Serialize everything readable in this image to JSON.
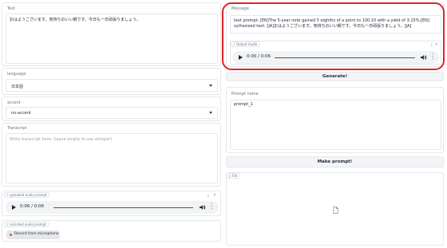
{
  "left": {
    "text": {
      "label": "Text",
      "value": "おはようございます。気持ちのいい朝です。今日も一日頑張りましょう。"
    },
    "language": {
      "label": "language",
      "selected": "日本語"
    },
    "accent": {
      "label": "accent",
      "selected": "no-accent"
    },
    "transcript": {
      "label": "Transcript",
      "placeholder": "Write transcript here. (leave empty to use whisper)"
    },
    "uploaded_audio": {
      "tag": "uploaded audio prompt",
      "time": "0:06 / 0:06"
    },
    "recorded_audio": {
      "tag": "recorded audio prompt",
      "record_label": "Record from microphone"
    }
  },
  "right": {
    "message": {
      "label": "Message",
      "line1": "text prompt: [EN]The 5-year note gained 5 eighths of a point to 100.10 with a yield of 3.15%.[EN]",
      "line2": "sythesized text: [JA]おはようございます。気持ちのいい朝です。今日も一日頑張りましょう。[JA]"
    },
    "output_audio": {
      "tag": "Output Audio",
      "time": "0:00 / 0:06"
    },
    "generate_label": "Generate!",
    "prompt_name": {
      "label": "Prompt name",
      "value": "prompt_1"
    },
    "make_prompt_label": "Make prompt!",
    "file": {
      "tag": "File"
    }
  },
  "colors": {
    "highlight": "#dc2626",
    "border": "#e5e7eb",
    "record_dot": "#ef4444"
  }
}
